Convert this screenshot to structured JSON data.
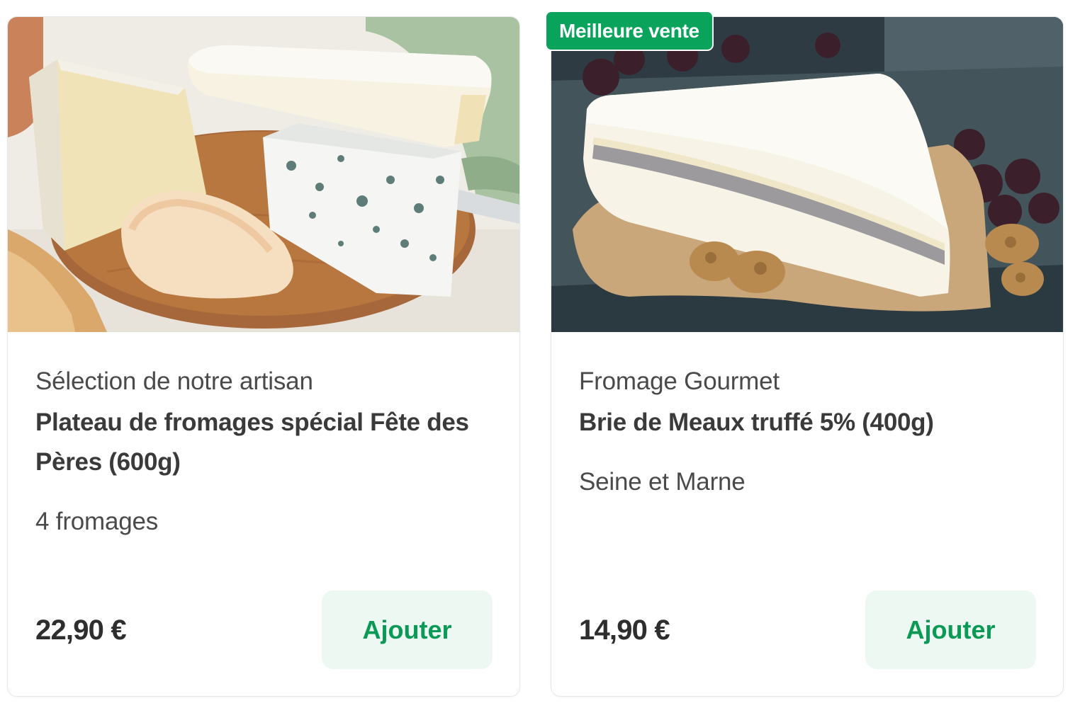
{
  "products": [
    {
      "badge": "",
      "image_alt": "cheese-board-photo",
      "vendor": "Sélection de notre artisan",
      "title": "Plateau de fromages spécial Fête des Pères (600g)",
      "meta": "4 fromages",
      "price": "22,90 €",
      "add_label": "Ajouter"
    },
    {
      "badge": "Meilleure vente",
      "image_alt": "truffled-brie-photo",
      "vendor": "Fromage Gourmet",
      "title": "Brie de Meaux truffé 5% (400g)",
      "meta": "Seine et Marne",
      "price": "14,90 €",
      "add_label": "Ajouter"
    }
  ],
  "colors": {
    "accent_green": "#0aa35b",
    "button_bg": "#eef8f2",
    "button_text": "#0b9a55"
  }
}
